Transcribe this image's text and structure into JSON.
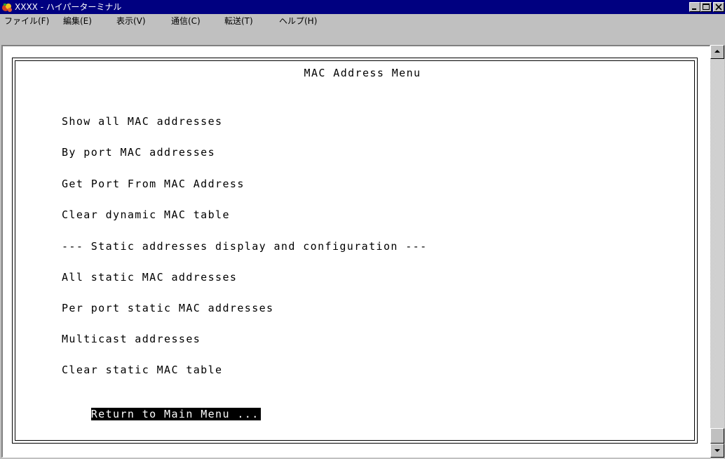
{
  "window": {
    "title": "XXXX - ハイパーターミナル"
  },
  "menubar": {
    "items": [
      {
        "label": "ファイル(F)"
      },
      {
        "label": "編集(E)"
      },
      {
        "label": "表示(V)"
      },
      {
        "label": "通信(C)"
      },
      {
        "label": "転送(T)"
      },
      {
        "label": "ヘルプ(H)"
      }
    ]
  },
  "terminal": {
    "title": "MAC Address Menu",
    "items": [
      {
        "label": "Show all MAC addresses"
      },
      {
        "label": "By port MAC addresses"
      },
      {
        "label": "Get Port From MAC Address"
      },
      {
        "label": "Clear dynamic MAC table"
      },
      {
        "label": "--- Static addresses display and configuration ---"
      },
      {
        "label": "All static MAC addresses"
      },
      {
        "label": "Per port static MAC addresses"
      },
      {
        "label": "Multicast addresses"
      },
      {
        "label": "Clear static MAC table"
      },
      {
        "label": "Return to Main Menu ..."
      }
    ],
    "selected_item": "Return to Main Menu ..."
  },
  "colors": {
    "titlebar": "#000080",
    "selection_bg": "#000000",
    "selection_fg": "#ffffff"
  },
  "icons": {
    "app": "hyperterminal-icon",
    "minimize": "minimize-icon",
    "maximize": "maximize-icon",
    "close": "close-icon",
    "scroll_up": "arrow-up-icon",
    "scroll_down": "arrow-down-icon"
  }
}
